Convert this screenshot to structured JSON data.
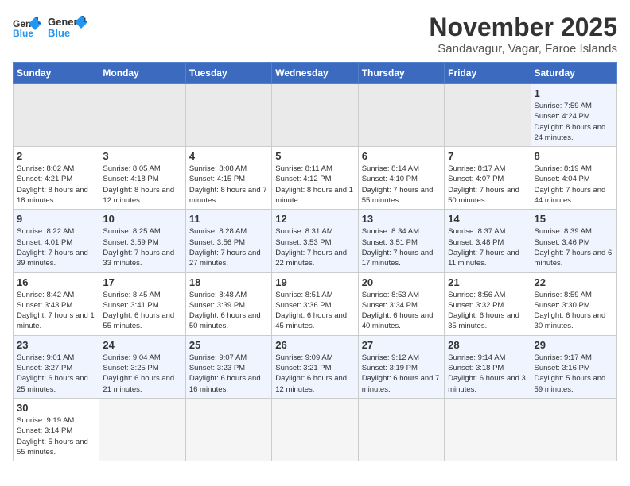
{
  "header": {
    "logo_general": "General",
    "logo_blue": "Blue",
    "month_title": "November 2025",
    "location": "Sandavagur, Vagar, Faroe Islands"
  },
  "weekdays": [
    "Sunday",
    "Monday",
    "Tuesday",
    "Wednesday",
    "Thursday",
    "Friday",
    "Saturday"
  ],
  "weeks": [
    [
      {
        "day": "",
        "info": ""
      },
      {
        "day": "",
        "info": ""
      },
      {
        "day": "",
        "info": ""
      },
      {
        "day": "",
        "info": ""
      },
      {
        "day": "",
        "info": ""
      },
      {
        "day": "",
        "info": ""
      },
      {
        "day": "1",
        "info": "Sunrise: 7:59 AM\nSunset: 4:24 PM\nDaylight: 8 hours\nand 24 minutes."
      }
    ],
    [
      {
        "day": "2",
        "info": "Sunrise: 8:02 AM\nSunset: 4:21 PM\nDaylight: 8 hours\nand 18 minutes."
      },
      {
        "day": "3",
        "info": "Sunrise: 8:05 AM\nSunset: 4:18 PM\nDaylight: 8 hours\nand 12 minutes."
      },
      {
        "day": "4",
        "info": "Sunrise: 8:08 AM\nSunset: 4:15 PM\nDaylight: 8 hours\nand 7 minutes."
      },
      {
        "day": "5",
        "info": "Sunrise: 8:11 AM\nSunset: 4:12 PM\nDaylight: 8 hours\nand 1 minute."
      },
      {
        "day": "6",
        "info": "Sunrise: 8:14 AM\nSunset: 4:10 PM\nDaylight: 7 hours\nand 55 minutes."
      },
      {
        "day": "7",
        "info": "Sunrise: 8:17 AM\nSunset: 4:07 PM\nDaylight: 7 hours\nand 50 minutes."
      },
      {
        "day": "8",
        "info": "Sunrise: 8:19 AM\nSunset: 4:04 PM\nDaylight: 7 hours\nand 44 minutes."
      }
    ],
    [
      {
        "day": "9",
        "info": "Sunrise: 8:22 AM\nSunset: 4:01 PM\nDaylight: 7 hours\nand 39 minutes."
      },
      {
        "day": "10",
        "info": "Sunrise: 8:25 AM\nSunset: 3:59 PM\nDaylight: 7 hours\nand 33 minutes."
      },
      {
        "day": "11",
        "info": "Sunrise: 8:28 AM\nSunset: 3:56 PM\nDaylight: 7 hours\nand 27 minutes."
      },
      {
        "day": "12",
        "info": "Sunrise: 8:31 AM\nSunset: 3:53 PM\nDaylight: 7 hours\nand 22 minutes."
      },
      {
        "day": "13",
        "info": "Sunrise: 8:34 AM\nSunset: 3:51 PM\nDaylight: 7 hours\nand 17 minutes."
      },
      {
        "day": "14",
        "info": "Sunrise: 8:37 AM\nSunset: 3:48 PM\nDaylight: 7 hours\nand 11 minutes."
      },
      {
        "day": "15",
        "info": "Sunrise: 8:39 AM\nSunset: 3:46 PM\nDaylight: 7 hours\nand 6 minutes."
      }
    ],
    [
      {
        "day": "16",
        "info": "Sunrise: 8:42 AM\nSunset: 3:43 PM\nDaylight: 7 hours\nand 1 minute."
      },
      {
        "day": "17",
        "info": "Sunrise: 8:45 AM\nSunset: 3:41 PM\nDaylight: 6 hours\nand 55 minutes."
      },
      {
        "day": "18",
        "info": "Sunrise: 8:48 AM\nSunset: 3:39 PM\nDaylight: 6 hours\nand 50 minutes."
      },
      {
        "day": "19",
        "info": "Sunrise: 8:51 AM\nSunset: 3:36 PM\nDaylight: 6 hours\nand 45 minutes."
      },
      {
        "day": "20",
        "info": "Sunrise: 8:53 AM\nSunset: 3:34 PM\nDaylight: 6 hours\nand 40 minutes."
      },
      {
        "day": "21",
        "info": "Sunrise: 8:56 AM\nSunset: 3:32 PM\nDaylight: 6 hours\nand 35 minutes."
      },
      {
        "day": "22",
        "info": "Sunrise: 8:59 AM\nSunset: 3:30 PM\nDaylight: 6 hours\nand 30 minutes."
      }
    ],
    [
      {
        "day": "23",
        "info": "Sunrise: 9:01 AM\nSunset: 3:27 PM\nDaylight: 6 hours\nand 25 minutes."
      },
      {
        "day": "24",
        "info": "Sunrise: 9:04 AM\nSunset: 3:25 PM\nDaylight: 6 hours\nand 21 minutes."
      },
      {
        "day": "25",
        "info": "Sunrise: 9:07 AM\nSunset: 3:23 PM\nDaylight: 6 hours\nand 16 minutes."
      },
      {
        "day": "26",
        "info": "Sunrise: 9:09 AM\nSunset: 3:21 PM\nDaylight: 6 hours\nand 12 minutes."
      },
      {
        "day": "27",
        "info": "Sunrise: 9:12 AM\nSunset: 3:19 PM\nDaylight: 6 hours\nand 7 minutes."
      },
      {
        "day": "28",
        "info": "Sunrise: 9:14 AM\nSunset: 3:18 PM\nDaylight: 6 hours\nand 3 minutes."
      },
      {
        "day": "29",
        "info": "Sunrise: 9:17 AM\nSunset: 3:16 PM\nDaylight: 5 hours\nand 59 minutes."
      }
    ],
    [
      {
        "day": "30",
        "info": "Sunrise: 9:19 AM\nSunset: 3:14 PM\nDaylight: 5 hours\nand 55 minutes."
      },
      {
        "day": "",
        "info": ""
      },
      {
        "day": "",
        "info": ""
      },
      {
        "day": "",
        "info": ""
      },
      {
        "day": "",
        "info": ""
      },
      {
        "day": "",
        "info": ""
      },
      {
        "day": "",
        "info": ""
      }
    ]
  ]
}
